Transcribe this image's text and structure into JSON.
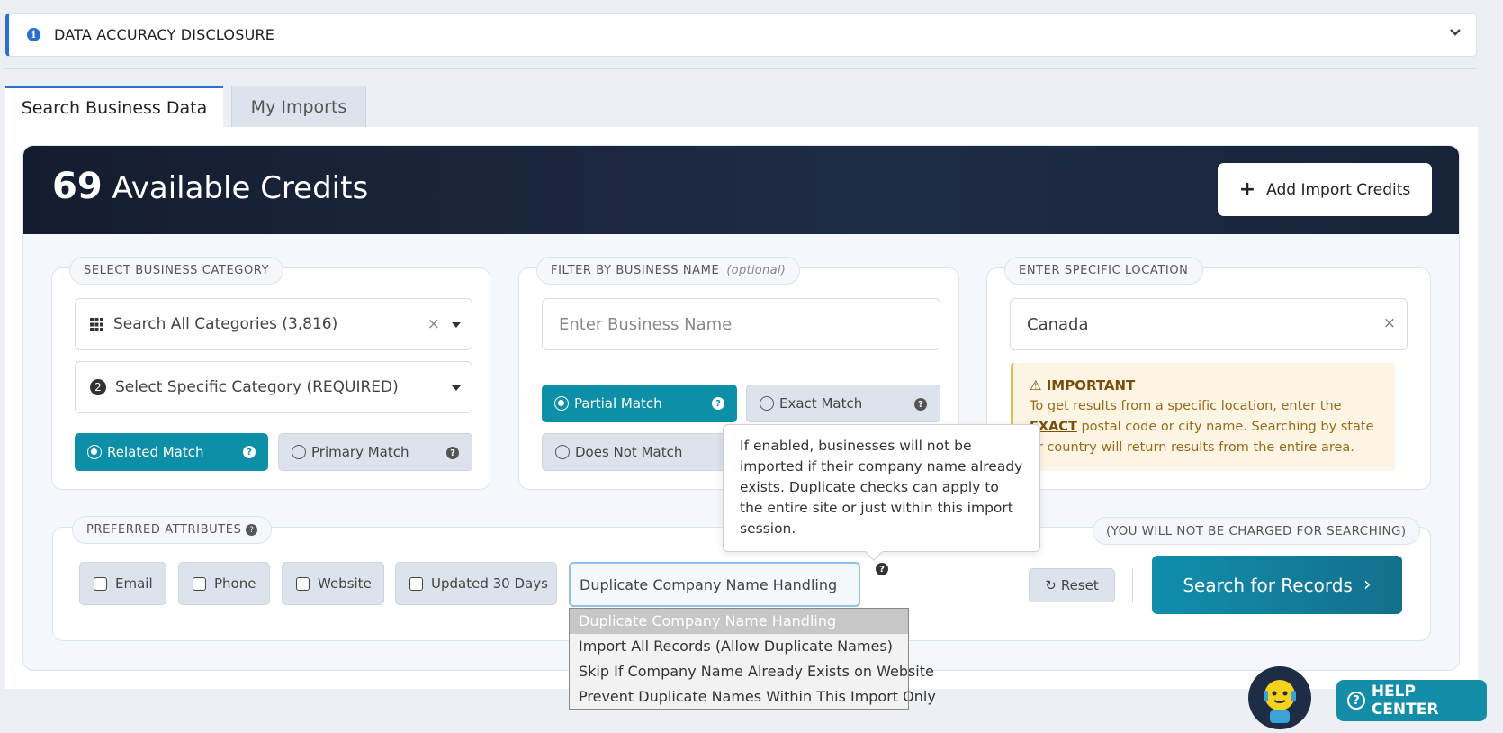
{
  "disclosure": {
    "title": "DATA ACCURACY DISCLOSURE"
  },
  "tabs": [
    {
      "label": "Search Business Data",
      "active": true
    },
    {
      "label": "My Imports",
      "active": false
    }
  ],
  "credits": {
    "count": "69",
    "label": "Available Credits",
    "add_button": "Add Import Credits"
  },
  "category": {
    "section_label": "SELECT BUSINESS CATEGORY",
    "all_categories": "Search All Categories (3,816)",
    "specific_category": "Select Specific Category (REQUIRED)",
    "related_match": "Related Match",
    "primary_match": "Primary Match"
  },
  "business_name": {
    "section_label": "FILTER BY BUSINESS NAME",
    "optional": "(optional)",
    "placeholder": "Enter Business Name",
    "partial_match": "Partial Match",
    "exact_match": "Exact Match",
    "does_not_match": "Does Not Match"
  },
  "location": {
    "section_label": "ENTER SPECIFIC LOCATION",
    "value": "Canada",
    "important_title": "IMPORTANT",
    "important_text_1": "To get results from a specific location, enter the",
    "important_exact": "EXACT",
    "important_text_2": "postal code or city name. Searching by state or country will return results from the entire area."
  },
  "attributes": {
    "section_label": "PREFERRED ATTRIBUTES",
    "no_charge": "(YOU WILL NOT BE CHARGED FOR SEARCHING)",
    "email": "Email",
    "phone": "Phone",
    "website": "Website",
    "updated": "Updated 30 Days",
    "duplicate_selected": "Duplicate Company Name Handling",
    "duplicate_options": [
      "Duplicate Company Name Handling",
      "Import All Records (Allow Duplicate Names)",
      "Skip If Company Name Already Exists on Website",
      "Prevent Duplicate Names Within This Import Only"
    ],
    "tooltip": "If enabled, businesses will not be imported if their company name already exists. Duplicate checks can apply to the entire site or just within this import session.",
    "reset": "Reset",
    "search": "Search for Records"
  },
  "help": {
    "label": "HELP CENTER"
  },
  "colors": {
    "accent": "#0e8fa8",
    "navy": "#1a2740",
    "link_blue": "#2c6fd1"
  }
}
